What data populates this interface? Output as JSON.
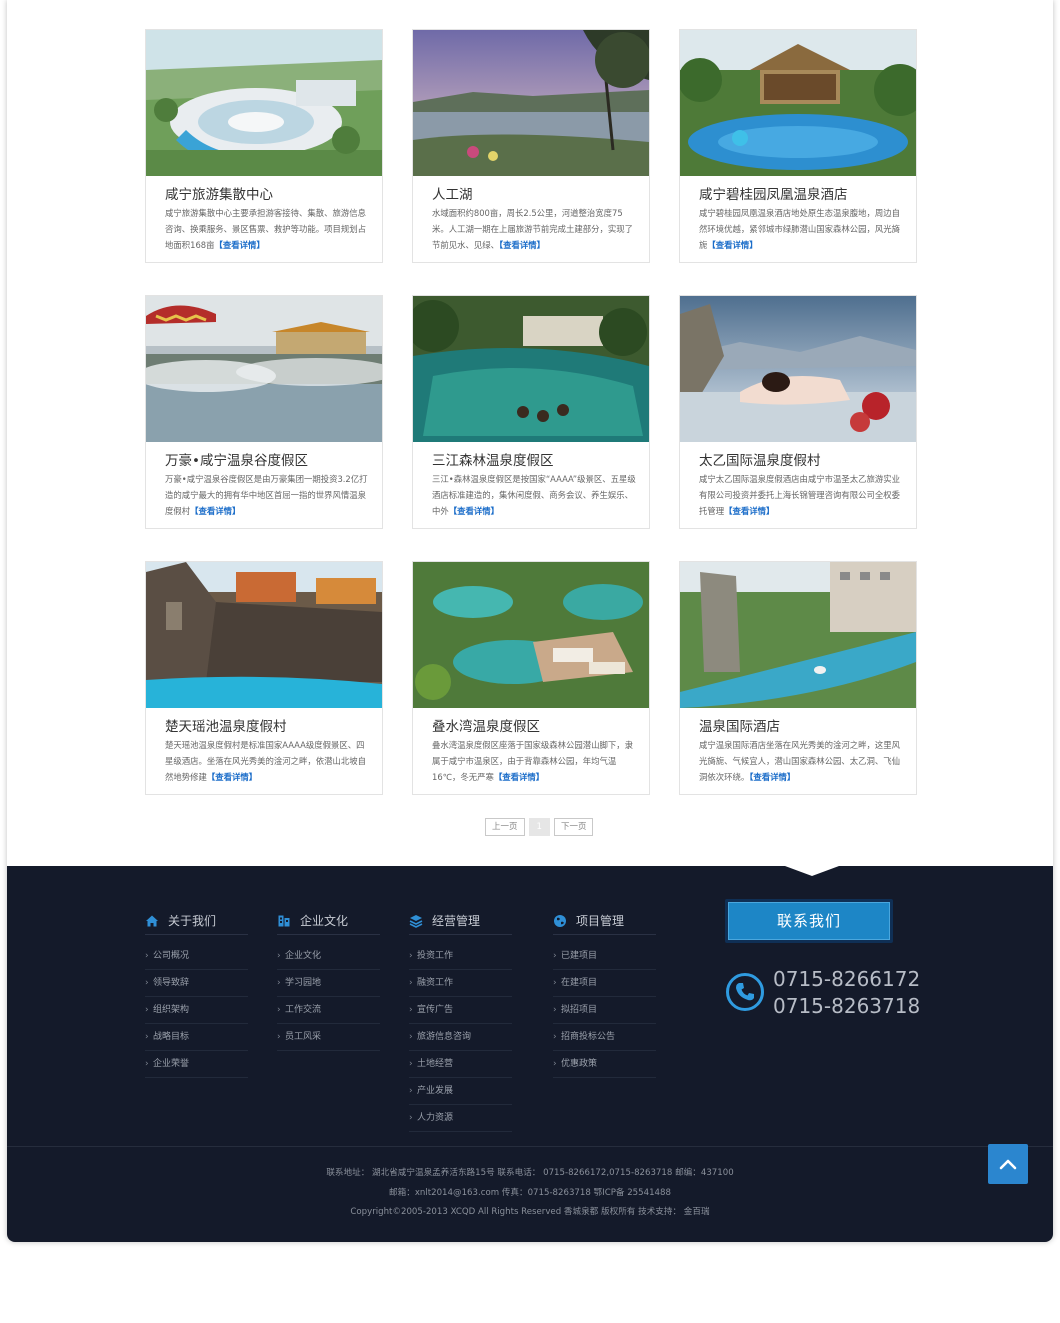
{
  "cards": [
    {
      "title": "咸宁旅游集散中心",
      "desc": "咸宁旅游集散中心主要承担游客接待、集散、旅游信息咨询、换乘服务、景区售票、救护等功能。项目规划占地面积168亩",
      "more": "【查看详情】",
      "image": "aerial-plaza-photo"
    },
    {
      "title": "人工湖",
      "desc": "水域面积约800亩，周长2.5公里，河道整治宽度75米。人工湖一期在上届旅游节前完成土建部分，实现了节前见水、见绿、",
      "more": "【查看详情】",
      "image": "lake-sunset-photo"
    },
    {
      "title": "咸宁碧桂园凤凰温泉酒店",
      "desc": "咸宁碧桂园凤凰温泉酒店地处原生态温泉腹地，周边自然环境优越，紧邻城市绿肺潜山国家森林公园，风光旖旎",
      "more": "【查看详情】",
      "image": "thatched-pavilion-pool-photo"
    },
    {
      "title": "万豪•咸宁温泉谷度假区",
      "desc": "万豪•咸宁温泉谷度假区是由万豪集团一期投资3.2亿打造的咸宁最大的拥有华中地区首屈一指的世界风情温泉度假村",
      "more": "【查看详情】",
      "image": "steaming-hot-spring-photo"
    },
    {
      "title": "三江森林温泉度假区",
      "desc": "三江•森林温泉度假区是按国家“AAAA”级景区、五星级酒店标准建造的，集休闲度假、商务会议、养生娱乐、中外",
      "more": "【查看详情】",
      "image": "forest-pool-bathers-photo"
    },
    {
      "title": "太乙国际温泉度假村",
      "desc": "咸宁太乙国际温泉度假酒店由咸宁市温圣太乙旅游实业有限公司投资并委托上海长锦管理咨询有限公司全权委托管理",
      "more": "【查看详情】",
      "image": "woman-in-spring-photo"
    },
    {
      "title": "楚天瑶池温泉度假村",
      "desc": "楚天瑶池温泉度假村是标准国家AAAA级度假景区、四星级酒店。坐落在风光秀美的淦河之畔，依潜山北坡自然地势修建",
      "more": "【查看详情】",
      "image": "rock-waterfall-pool-photo"
    },
    {
      "title": "叠水湾温泉度假区",
      "desc": "叠水湾温泉度假区座落于国家级森林公园潜山脚下，隶属于咸宁市温泉区，由于背靠森林公园，年均气温16℃，冬无严寒",
      "more": "【查看详情】",
      "image": "garden-pools-loungers-photo"
    },
    {
      "title": "温泉国际酒店",
      "desc": "咸宁温泉国际酒店坐落在风光秀美的淦河之畔，这里风光旖旎、气候宜人，潜山国家森林公园、太乙洞、飞仙洞依次环绕。",
      "more": "【查看详情】",
      "image": "lazy-river-pool-photo"
    }
  ],
  "pager": {
    "prev": "上一页",
    "current": "1",
    "next": "下一页"
  },
  "footer": {
    "columns": [
      {
        "heading": "关于我们",
        "icon": "home-icon",
        "items": [
          "公司概况",
          "领导致辞",
          "组织架构",
          "战略目标",
          "企业荣誉"
        ]
      },
      {
        "heading": "企业文化",
        "icon": "building-icon",
        "items": [
          "企业文化",
          "学习园地",
          "工作交流",
          "员工风采"
        ]
      },
      {
        "heading": "经营管理",
        "icon": "layers-icon",
        "items": [
          "投资工作",
          "融资工作",
          "宣传广告",
          "旅游信息咨询",
          "土地经营",
          "产业发展",
          "人力资源"
        ]
      },
      {
        "heading": "项目管理",
        "icon": "globe-icon",
        "items": [
          "已建项目",
          "在建项目",
          "拟招项目",
          "招商投标公告",
          "优惠政策"
        ]
      }
    ],
    "contact_button": "联系我们",
    "phones": [
      "0715-8266172",
      "0715-8263718"
    ],
    "copyright_lines": [
      "联系地址：  湖北省咸宁温泉孟养活东路15号    联系电话：  0715-8266172,0715-8263718  邮编：437100",
      "邮箱：xnlt2014@163.com    传真：0715-8263718   鄂ICP备 25541488",
      "Copyright©2005-2013 XCQD All Rights Reserved 香城泉都 版权所有   技术支持：  金百瑞"
    ]
  },
  "colors": {
    "accent": "#1b6dc9",
    "footer_bg": "#141a2a",
    "button_blue": "#1d86c6"
  }
}
